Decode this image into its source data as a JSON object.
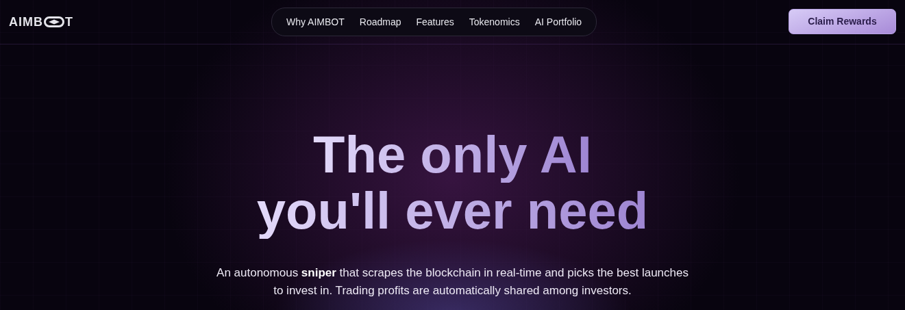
{
  "logo": {
    "text_before_icon": "AIMB",
    "text_after_icon": "T"
  },
  "nav": {
    "links": [
      "Why AIMBOT",
      "Roadmap",
      "Features",
      "Tokenomics",
      "AI Portfolio"
    ]
  },
  "cta_button": "Claim Rewards",
  "hero": {
    "headline_lines": [
      "The only AI",
      "you'll ever need"
    ],
    "subtitle": "An autonomous **sniper** that scrapes the blockchain in real-time and picks the best launches to invest in. Trading profits are automatically shared among investors."
  }
}
